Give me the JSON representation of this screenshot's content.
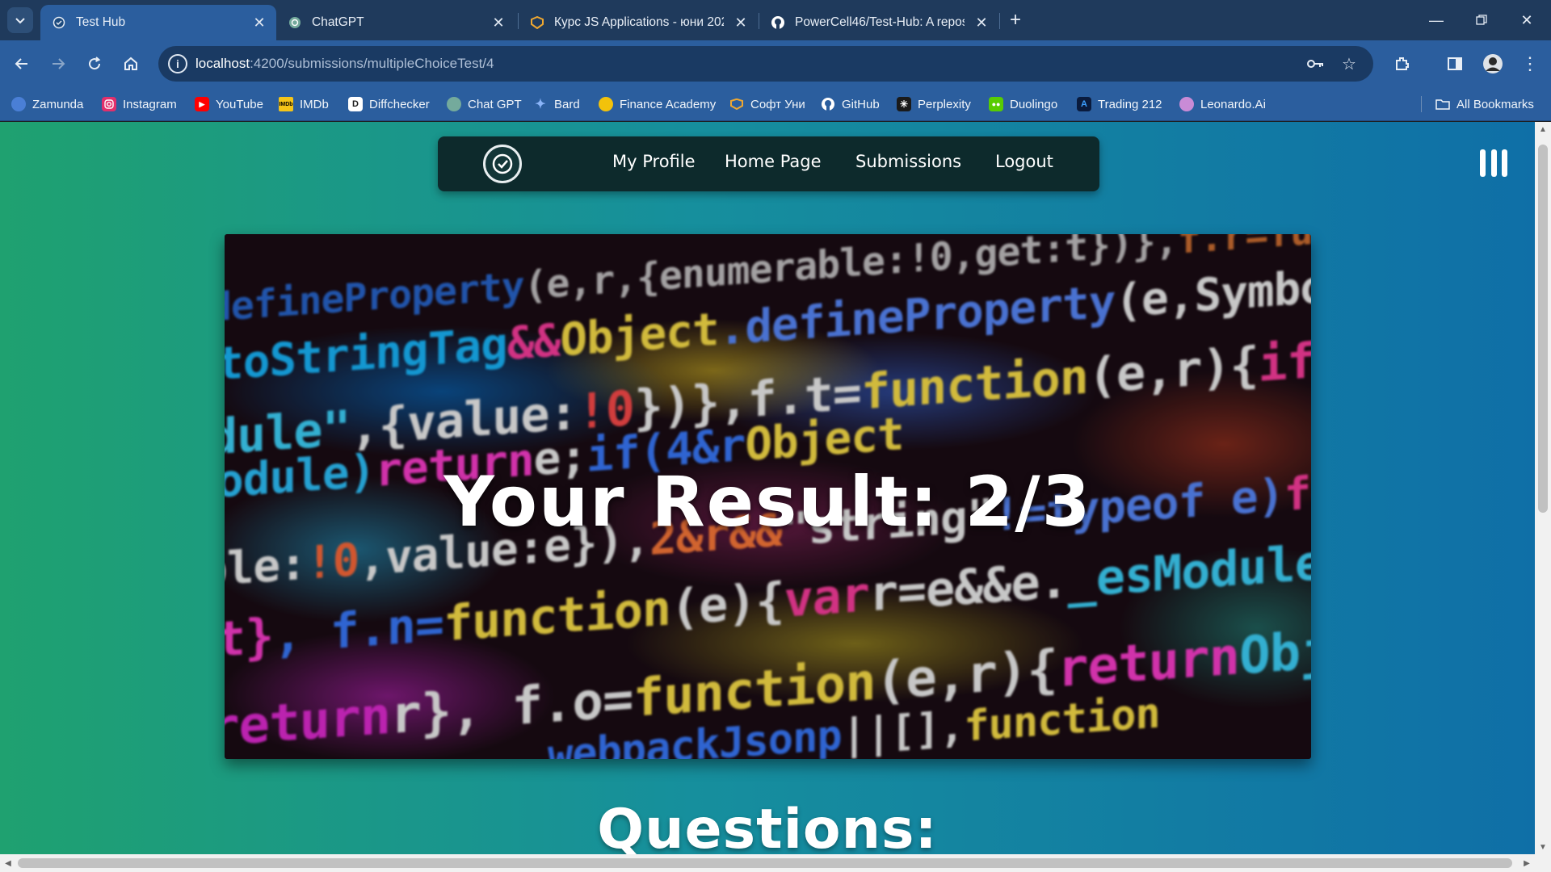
{
  "browser": {
    "tabs": [
      {
        "title": "Test Hub",
        "active": true
      },
      {
        "title": "ChatGPT",
        "active": false
      },
      {
        "title": "Курс JS Applications - юни 202",
        "active": false
      },
      {
        "title": "PowerCell46/Test-Hub: A reposi",
        "active": false
      }
    ],
    "url_host": "localhost",
    "url_path": ":4200/submissions/multipleChoiceTest/4",
    "bookmarks": [
      {
        "label": "Zamunda",
        "color": "#4a7fd6"
      },
      {
        "label": "Instagram",
        "color": "#e1306c"
      },
      {
        "label": "YouTube",
        "color": "#ff0000"
      },
      {
        "label": "IMDb",
        "color": "#f5c518"
      },
      {
        "label": "Diffchecker",
        "color": "#1a1a1a"
      },
      {
        "label": "Chat GPT",
        "color": "#74aa9c"
      },
      {
        "label": "Bard",
        "color": "#8ab4f8"
      },
      {
        "label": "Finance Academy",
        "color": "#f2c20b"
      },
      {
        "label": "Софт Уни",
        "color": "#f0a830"
      },
      {
        "label": "GitHub",
        "color": "#ffffff"
      },
      {
        "label": "Perplexity",
        "color": "#20808d"
      },
      {
        "label": "Duolingo",
        "color": "#58cc02"
      },
      {
        "label": "Trading 212",
        "color": "#0066ff"
      },
      {
        "label": "Leonardo.Ai",
        "color": "#c98bd6"
      }
    ],
    "all_bookmarks": "All Bookmarks"
  },
  "nav": {
    "links": [
      "My Profile",
      "Home Page",
      "Submissions",
      "Logout"
    ]
  },
  "hero": {
    "title": "Your Result: 2/3"
  },
  "questions": {
    "heading": "Questions:"
  },
  "colors": {
    "page_gradient_start": "#1fa170",
    "page_gradient_end": "#0f6fa7",
    "navbar": "#0d2a2c",
    "browser_frame": "#2b5e9e"
  }
}
